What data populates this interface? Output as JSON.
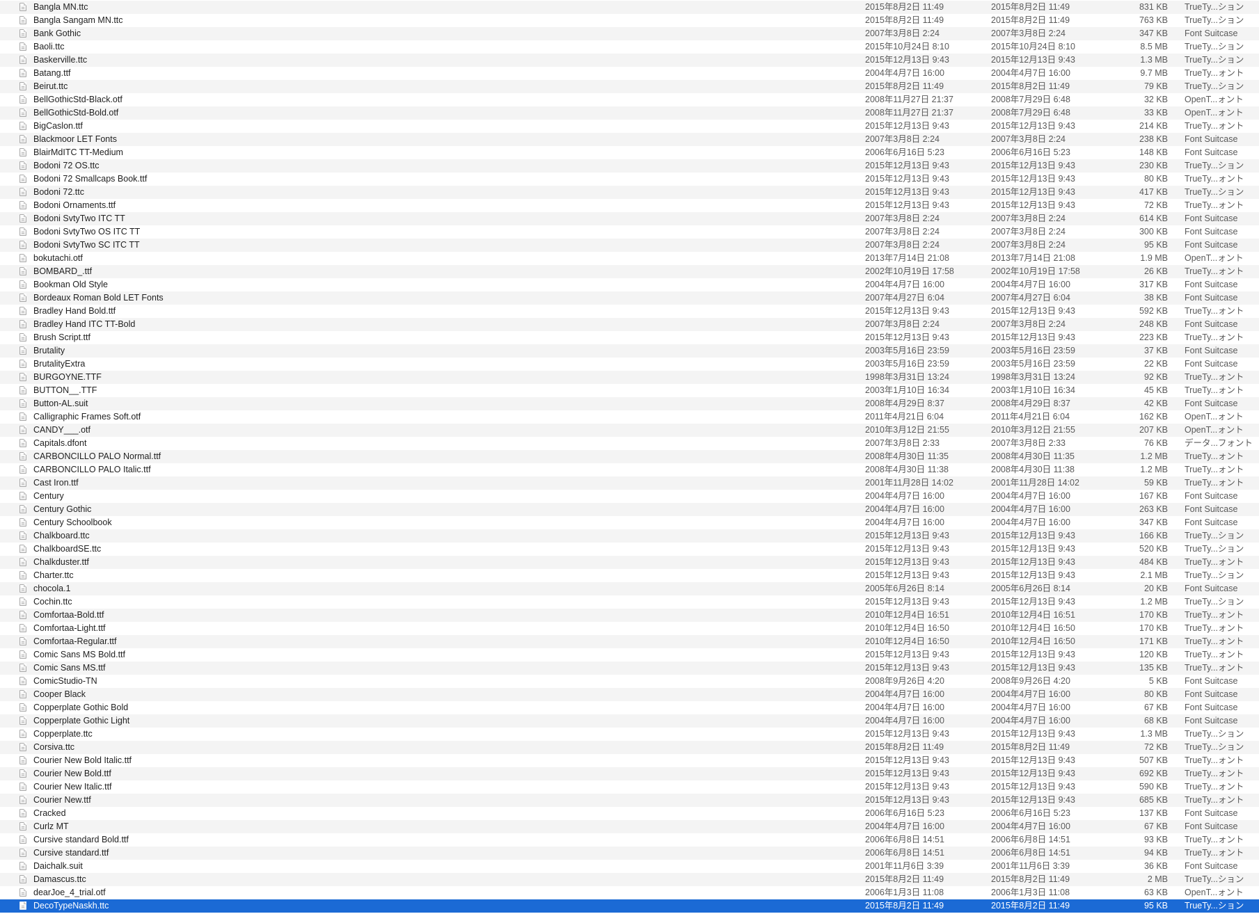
{
  "colors": {
    "row_alternate": "#f4f4f4",
    "row_default": "#ffffff",
    "selection": "#1b6ad5",
    "secondary_text": "#5a5a5a"
  },
  "icons": {
    "file": "document-icon"
  },
  "selected_index": 68,
  "files": [
    {
      "name": "Bangla MN.ttc",
      "created": "2015年8月2日 11:49",
      "modified": "2015年8月2日 11:49",
      "size": "831 KB",
      "kind": "TrueTy...ション"
    },
    {
      "name": "Bangla Sangam MN.ttc",
      "created": "2015年8月2日 11:49",
      "modified": "2015年8月2日 11:49",
      "size": "763 KB",
      "kind": "TrueTy...ション"
    },
    {
      "name": "Bank Gothic",
      "created": "2007年3月8日 2:24",
      "modified": "2007年3月8日 2:24",
      "size": "347 KB",
      "kind": "Font Suitcase"
    },
    {
      "name": "Baoli.ttc",
      "created": "2015年10月24日 8:10",
      "modified": "2015年10月24日 8:10",
      "size": "8.5 MB",
      "kind": "TrueTy...ション"
    },
    {
      "name": "Baskerville.ttc",
      "created": "2015年12月13日 9:43",
      "modified": "2015年12月13日 9:43",
      "size": "1.3 MB",
      "kind": "TrueTy...ション"
    },
    {
      "name": "Batang.ttf",
      "created": "2004年4月7日 16:00",
      "modified": "2004年4月7日 16:00",
      "size": "9.7 MB",
      "kind": "TrueTy...ォント"
    },
    {
      "name": "Beirut.ttc",
      "created": "2015年8月2日 11:49",
      "modified": "2015年8月2日 11:49",
      "size": "79 KB",
      "kind": "TrueTy...ション"
    },
    {
      "name": "BellGothicStd-Black.otf",
      "created": "2008年11月27日 21:37",
      "modified": "2008年7月29日 6:48",
      "size": "32 KB",
      "kind": "OpenT...ォント"
    },
    {
      "name": "BellGothicStd-Bold.otf",
      "created": "2008年11月27日 21:37",
      "modified": "2008年7月29日 6:48",
      "size": "33 KB",
      "kind": "OpenT...ォント"
    },
    {
      "name": "BigCaslon.ttf",
      "created": "2015年12月13日 9:43",
      "modified": "2015年12月13日 9:43",
      "size": "214 KB",
      "kind": "TrueTy...ォント"
    },
    {
      "name": "Blackmoor LET Fonts",
      "created": "2007年3月8日 2:24",
      "modified": "2007年3月8日 2:24",
      "size": "238 KB",
      "kind": "Font Suitcase"
    },
    {
      "name": "BlairMdITC TT-Medium",
      "created": "2006年6月16日 5:23",
      "modified": "2006年6月16日 5:23",
      "size": "148 KB",
      "kind": "Font Suitcase"
    },
    {
      "name": "Bodoni 72 OS.ttc",
      "created": "2015年12月13日 9:43",
      "modified": "2015年12月13日 9:43",
      "size": "230 KB",
      "kind": "TrueTy...ション"
    },
    {
      "name": "Bodoni 72 Smallcaps Book.ttf",
      "created": "2015年12月13日 9:43",
      "modified": "2015年12月13日 9:43",
      "size": "80 KB",
      "kind": "TrueTy...ォント"
    },
    {
      "name": "Bodoni 72.ttc",
      "created": "2015年12月13日 9:43",
      "modified": "2015年12月13日 9:43",
      "size": "417 KB",
      "kind": "TrueTy...ション"
    },
    {
      "name": "Bodoni Ornaments.ttf",
      "created": "2015年12月13日 9:43",
      "modified": "2015年12月13日 9:43",
      "size": "72 KB",
      "kind": "TrueTy...ォント"
    },
    {
      "name": "Bodoni SvtyTwo ITC TT",
      "created": "2007年3月8日 2:24",
      "modified": "2007年3月8日 2:24",
      "size": "614 KB",
      "kind": "Font Suitcase"
    },
    {
      "name": "Bodoni SvtyTwo OS ITC TT",
      "created": "2007年3月8日 2:24",
      "modified": "2007年3月8日 2:24",
      "size": "300 KB",
      "kind": "Font Suitcase"
    },
    {
      "name": "Bodoni SvtyTwo SC ITC TT",
      "created": "2007年3月8日 2:24",
      "modified": "2007年3月8日 2:24",
      "size": "95 KB",
      "kind": "Font Suitcase"
    },
    {
      "name": "bokutachi.otf",
      "created": "2013年7月14日 21:08",
      "modified": "2013年7月14日 21:08",
      "size": "1.9 MB",
      "kind": "OpenT...ォント"
    },
    {
      "name": "BOMBARD_.ttf",
      "created": "2002年10月19日 17:58",
      "modified": "2002年10月19日 17:58",
      "size": "26 KB",
      "kind": "TrueTy...ォント"
    },
    {
      "name": "Bookman Old Style",
      "created": "2004年4月7日 16:00",
      "modified": "2004年4月7日 16:00",
      "size": "317 KB",
      "kind": "Font Suitcase"
    },
    {
      "name": "Bordeaux Roman Bold LET Fonts",
      "created": "2007年4月27日 6:04",
      "modified": "2007年4月27日 6:04",
      "size": "38 KB",
      "kind": "Font Suitcase"
    },
    {
      "name": "Bradley Hand Bold.ttf",
      "created": "2015年12月13日 9:43",
      "modified": "2015年12月13日 9:43",
      "size": "592 KB",
      "kind": "TrueTy...ォント"
    },
    {
      "name": "Bradley Hand ITC TT-Bold",
      "created": "2007年3月8日 2:24",
      "modified": "2007年3月8日 2:24",
      "size": "248 KB",
      "kind": "Font Suitcase"
    },
    {
      "name": "Brush Script.ttf",
      "created": "2015年12月13日 9:43",
      "modified": "2015年12月13日 9:43",
      "size": "223 KB",
      "kind": "TrueTy...ォント"
    },
    {
      "name": "Brutality",
      "created": "2003年5月16日 23:59",
      "modified": "2003年5月16日 23:59",
      "size": "37 KB",
      "kind": "Font Suitcase"
    },
    {
      "name": "BrutalityExtra",
      "created": "2003年5月16日 23:59",
      "modified": "2003年5月16日 23:59",
      "size": "22 KB",
      "kind": "Font Suitcase"
    },
    {
      "name": "BURGOYNE.TTF",
      "created": "1998年3月31日 13:24",
      "modified": "1998年3月31日 13:24",
      "size": "92 KB",
      "kind": "TrueTy...ォント"
    },
    {
      "name": "BUTTON__.TTF",
      "created": "2003年1月10日 16:34",
      "modified": "2003年1月10日 16:34",
      "size": "45 KB",
      "kind": "TrueTy...ォント"
    },
    {
      "name": "Button-AL.suit",
      "created": "2008年4月29日 8:37",
      "modified": "2008年4月29日 8:37",
      "size": "42 KB",
      "kind": "Font Suitcase"
    },
    {
      "name": "Calligraphic Frames Soft.otf",
      "created": "2011年4月21日 6:04",
      "modified": "2011年4月21日 6:04",
      "size": "162 KB",
      "kind": "OpenT...ォント"
    },
    {
      "name": "CANDY___.otf",
      "created": "2010年3月12日 21:55",
      "modified": "2010年3月12日 21:55",
      "size": "207 KB",
      "kind": "OpenT...ォント"
    },
    {
      "name": "Capitals.dfont",
      "created": "2007年3月8日 2:33",
      "modified": "2007年3月8日 2:33",
      "size": "76 KB",
      "kind": "データ...フォント"
    },
    {
      "name": "CARBONCILLO PALO   Normal.ttf",
      "created": "2008年4月30日 11:35",
      "modified": "2008年4月30日 11:35",
      "size": "1.2 MB",
      "kind": "TrueTy...ォント"
    },
    {
      "name": "CARBONCILLO PALO Italic.ttf",
      "created": "2008年4月30日 11:38",
      "modified": "2008年4月30日 11:38",
      "size": "1.2 MB",
      "kind": "TrueTy...ォント"
    },
    {
      "name": "Cast Iron.ttf",
      "created": "2001年11月28日 14:02",
      "modified": "2001年11月28日 14:02",
      "size": "59 KB",
      "kind": "TrueTy...ォント"
    },
    {
      "name": "Century",
      "created": "2004年4月7日 16:00",
      "modified": "2004年4月7日 16:00",
      "size": "167 KB",
      "kind": "Font Suitcase"
    },
    {
      "name": "Century Gothic",
      "created": "2004年4月7日 16:00",
      "modified": "2004年4月7日 16:00",
      "size": "263 KB",
      "kind": "Font Suitcase"
    },
    {
      "name": "Century Schoolbook",
      "created": "2004年4月7日 16:00",
      "modified": "2004年4月7日 16:00",
      "size": "347 KB",
      "kind": "Font Suitcase"
    },
    {
      "name": "Chalkboard.ttc",
      "created": "2015年12月13日 9:43",
      "modified": "2015年12月13日 9:43",
      "size": "166 KB",
      "kind": "TrueTy...ション"
    },
    {
      "name": "ChalkboardSE.ttc",
      "created": "2015年12月13日 9:43",
      "modified": "2015年12月13日 9:43",
      "size": "520 KB",
      "kind": "TrueTy...ション"
    },
    {
      "name": "Chalkduster.ttf",
      "created": "2015年12月13日 9:43",
      "modified": "2015年12月13日 9:43",
      "size": "484 KB",
      "kind": "TrueTy...ォント"
    },
    {
      "name": "Charter.ttc",
      "created": "2015年12月13日 9:43",
      "modified": "2015年12月13日 9:43",
      "size": "2.1 MB",
      "kind": "TrueTy...ション"
    },
    {
      "name": "chocola.1",
      "created": "2005年6月26日 8:14",
      "modified": "2005年6月26日 8:14",
      "size": "20 KB",
      "kind": "Font Suitcase"
    },
    {
      "name": "Cochin.ttc",
      "created": "2015年12月13日 9:43",
      "modified": "2015年12月13日 9:43",
      "size": "1.2 MB",
      "kind": "TrueTy...ション"
    },
    {
      "name": "Comfortaa-Bold.ttf",
      "created": "2010年12月4日 16:51",
      "modified": "2010年12月4日 16:51",
      "size": "170 KB",
      "kind": "TrueTy...ォント"
    },
    {
      "name": "Comfortaa-Light.ttf",
      "created": "2010年12月4日 16:50",
      "modified": "2010年12月4日 16:50",
      "size": "170 KB",
      "kind": "TrueTy...ォント"
    },
    {
      "name": "Comfortaa-Regular.ttf",
      "created": "2010年12月4日 16:50",
      "modified": "2010年12月4日 16:50",
      "size": "171 KB",
      "kind": "TrueTy...ォント"
    },
    {
      "name": "Comic Sans MS Bold.ttf",
      "created": "2015年12月13日 9:43",
      "modified": "2015年12月13日 9:43",
      "size": "120 KB",
      "kind": "TrueTy...ォント"
    },
    {
      "name": "Comic Sans MS.ttf",
      "created": "2015年12月13日 9:43",
      "modified": "2015年12月13日 9:43",
      "size": "135 KB",
      "kind": "TrueTy...ォント"
    },
    {
      "name": "ComicStudio-TN",
      "created": "2008年9月26日 4:20",
      "modified": "2008年9月26日 4:20",
      "size": "5 KB",
      "kind": "Font Suitcase"
    },
    {
      "name": "Cooper Black",
      "created": "2004年4月7日 16:00",
      "modified": "2004年4月7日 16:00",
      "size": "80 KB",
      "kind": "Font Suitcase"
    },
    {
      "name": "Copperplate Gothic Bold",
      "created": "2004年4月7日 16:00",
      "modified": "2004年4月7日 16:00",
      "size": "67 KB",
      "kind": "Font Suitcase"
    },
    {
      "name": "Copperplate Gothic Light",
      "created": "2004年4月7日 16:00",
      "modified": "2004年4月7日 16:00",
      "size": "68 KB",
      "kind": "Font Suitcase"
    },
    {
      "name": "Copperplate.ttc",
      "created": "2015年12月13日 9:43",
      "modified": "2015年12月13日 9:43",
      "size": "1.3 MB",
      "kind": "TrueTy...ション"
    },
    {
      "name": "Corsiva.ttc",
      "created": "2015年8月2日 11:49",
      "modified": "2015年8月2日 11:49",
      "size": "72 KB",
      "kind": "TrueTy...ション"
    },
    {
      "name": "Courier New Bold Italic.ttf",
      "created": "2015年12月13日 9:43",
      "modified": "2015年12月13日 9:43",
      "size": "507 KB",
      "kind": "TrueTy...ォント"
    },
    {
      "name": "Courier New Bold.ttf",
      "created": "2015年12月13日 9:43",
      "modified": "2015年12月13日 9:43",
      "size": "692 KB",
      "kind": "TrueTy...ォント"
    },
    {
      "name": "Courier New Italic.ttf",
      "created": "2015年12月13日 9:43",
      "modified": "2015年12月13日 9:43",
      "size": "590 KB",
      "kind": "TrueTy...ォント"
    },
    {
      "name": "Courier New.ttf",
      "created": "2015年12月13日 9:43",
      "modified": "2015年12月13日 9:43",
      "size": "685 KB",
      "kind": "TrueTy...ォント"
    },
    {
      "name": "Cracked",
      "created": "2006年6月16日 5:23",
      "modified": "2006年6月16日 5:23",
      "size": "137 KB",
      "kind": "Font Suitcase"
    },
    {
      "name": "Curlz MT",
      "created": "2004年4月7日 16:00",
      "modified": "2004年4月7日 16:00",
      "size": "67 KB",
      "kind": "Font Suitcase"
    },
    {
      "name": "Cursive standard Bold.ttf",
      "created": "2006年6月8日 14:51",
      "modified": "2006年6月8日 14:51",
      "size": "93 KB",
      "kind": "TrueTy...ォント"
    },
    {
      "name": "Cursive standard.ttf",
      "created": "2006年6月8日 14:51",
      "modified": "2006年6月8日 14:51",
      "size": "94 KB",
      "kind": "TrueTy...ォント"
    },
    {
      "name": "Daichalk.suit",
      "created": "2001年11月6日 3:39",
      "modified": "2001年11月6日 3:39",
      "size": "36 KB",
      "kind": "Font Suitcase"
    },
    {
      "name": "Damascus.ttc",
      "created": "2015年8月2日 11:49",
      "modified": "2015年8月2日 11:49",
      "size": "2 MB",
      "kind": "TrueTy...ション"
    },
    {
      "name": "dearJoe_4_trial.otf",
      "created": "2006年1月3日 11:08",
      "modified": "2006年1月3日 11:08",
      "size": "63 KB",
      "kind": "OpenT...ォント"
    },
    {
      "name": "DecoTypeNaskh.ttc",
      "created": "2015年8月2日 11:49",
      "modified": "2015年8月2日 11:49",
      "size": "95 KB",
      "kind": "TrueTy...ション"
    }
  ]
}
